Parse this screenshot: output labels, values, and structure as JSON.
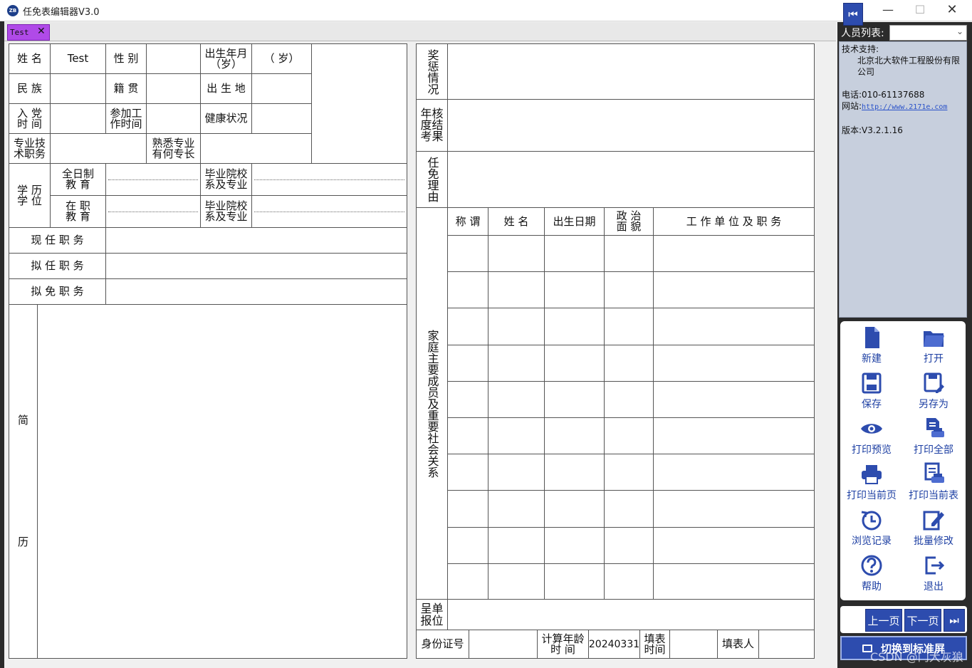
{
  "window": {
    "title": "任免表编辑器V3.0",
    "icon_text": "ZB",
    "min_glyph": "—",
    "max_glyph": "☐",
    "close_glyph": "✕"
  },
  "tabs": [
    {
      "label": "Test",
      "close_glyph": "✕",
      "color": "#b04ae8"
    }
  ],
  "basic_info": {
    "name_label": "姓 名",
    "name_value": "Test",
    "gender_label": "性 别",
    "gender_value": "",
    "birth_label_1": "出生年月",
    "birth_label_2": "（岁）",
    "age_value": "（  岁）",
    "ethnicity_label": "民 族",
    "native_label": "籍 贯",
    "birthplace_label": "出 生 地",
    "party_label_1": "入 党",
    "party_label_2": "时 间",
    "work_label_1": "参加工",
    "work_label_2": "作时间",
    "health_label": "健康状况",
    "title_label_1": "专业技",
    "title_label_2": "术职务",
    "specialty_label_1": "熟悉专业",
    "specialty_label_2": "有何专长"
  },
  "education": {
    "group_label_1": "学 历",
    "group_label_2": "学 位",
    "fulltime_label_1": "全日制",
    "fulltime_label_2": "教 育",
    "parttime_label_1": "在 职",
    "parttime_label_2": "教 育",
    "school_label_1": "毕业院校",
    "school_label_2": "系及专业"
  },
  "positions": {
    "current": "现 任 职 务",
    "proposed": "拟 任 职 务",
    "removed": "拟 免 职 务"
  },
  "resume": {
    "label_1": "简",
    "label_2": "历"
  },
  "right_form": {
    "awards": "奖惩情况",
    "assessment": "年核度结考果",
    "reason": "任免理由",
    "family": "家庭主要成员及重要社会关系",
    "family_headers": [
      "称 谓",
      "姓 名",
      "出生日期",
      "政 治",
      "面 貌",
      "工 作 单 位 及 职 务"
    ],
    "family_row_count": 10,
    "report_unit": "呈单报位",
    "id_label": "身份证号",
    "calc_age_label_1": "计算年龄",
    "calc_age_label_2": "时   间",
    "calc_age_value": "20240331",
    "fill_time_label_1": "填表",
    "fill_time_label_2": "时间",
    "filler_label": "填表人"
  },
  "sidebar": {
    "person_list_label": "人员列表:",
    "person_select_value": "",
    "info": {
      "support_label": "技术支持:",
      "company": "北京北大软件工程股份有限公司",
      "phone": "电话:010-61137688",
      "site_label": "网站:",
      "site_url": "http://www.2171e.com",
      "version": "版本:V3.2.1.16"
    },
    "tools": [
      {
        "label": "新建",
        "icon": "new-file-icon"
      },
      {
        "label": "打开",
        "icon": "open-folder-icon"
      },
      {
        "label": "保存",
        "icon": "save-icon"
      },
      {
        "label": "另存为",
        "icon": "save-as-icon"
      },
      {
        "label": "打印预览",
        "icon": "eye-icon"
      },
      {
        "label": "打印全部",
        "icon": "print-all-icon"
      },
      {
        "label": "打印当前页",
        "icon": "printer-icon"
      },
      {
        "label": "打印当前表",
        "icon": "print-table-icon"
      },
      {
        "label": "浏览记录",
        "icon": "history-icon"
      },
      {
        "label": "批量修改",
        "icon": "batch-edit-icon"
      },
      {
        "label": "帮助",
        "icon": "help-icon"
      },
      {
        "label": "退出",
        "icon": "exit-icon"
      }
    ],
    "nav": {
      "first_glyph": "⏮",
      "prev": "上一页",
      "next": "下一页",
      "last_glyph": "⏭"
    },
    "switch_label": "切换到标准屏",
    "watermark": "CSDN @门大灰狼"
  },
  "colors": {
    "accent": "#2d4cae",
    "tool_text": "#1d3fa3",
    "info_bg": "#c7cfdd"
  }
}
